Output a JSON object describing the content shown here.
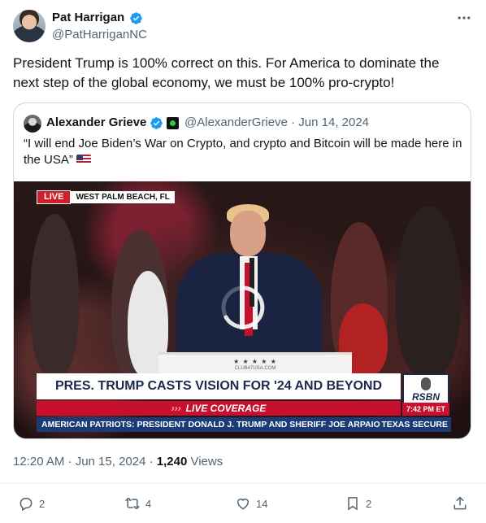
{
  "author": {
    "name": "Pat Harrigan",
    "handle": "@PatHarriganNC"
  },
  "tweet": {
    "text": "President Trump is 100% correct on this. For America to dominate the next step of the global economy, we must be 100% pro-crypto!",
    "timestamp": "12:20 AM · Jun 15, 2024 · ",
    "views_count": "1,240",
    "views_label": " Views"
  },
  "quote": {
    "name": "Alexander Grieve",
    "handle_date": "@AlexanderGrieve · Jun 14, 2024",
    "text": "“I will end Joe Biden’s War on Crypto, and crypto and Bitcoin will be made here in the USA”",
    "media": {
      "live_label": "LIVE",
      "location": "WEST PALM BEACH, FL",
      "headline": "PRES. TRUMP CASTS VISION FOR '24 AND BEYOND",
      "live_coverage": "LIVE COVERAGE",
      "live_arrows": "›››",
      "network": "RSBN",
      "time": "7:42 PM ET",
      "ticker_left": "AMERICAN PATRIOTS: PRESIDENT DONALD J. TRUMP AND SHERIFF JOE ARPAIO",
      "ticker_right": "TEXAS SECURE",
      "podium_stars": "★ ★ ★ ★ ★",
      "podium_url": "CLUB47USA.COM"
    }
  },
  "actions": {
    "replies": "2",
    "reposts": "4",
    "likes": "14",
    "bookmarks": "2"
  },
  "colors": {
    "verified": "#1d9bf0",
    "text_secondary": "#536471",
    "live_red": "#c8102e",
    "ticker_blue": "#1b3a78"
  },
  "icons": [
    "verified-icon",
    "more-icon",
    "reply-icon",
    "repost-icon",
    "like-icon",
    "bookmark-icon",
    "share-icon",
    "flag-us-icon"
  ]
}
